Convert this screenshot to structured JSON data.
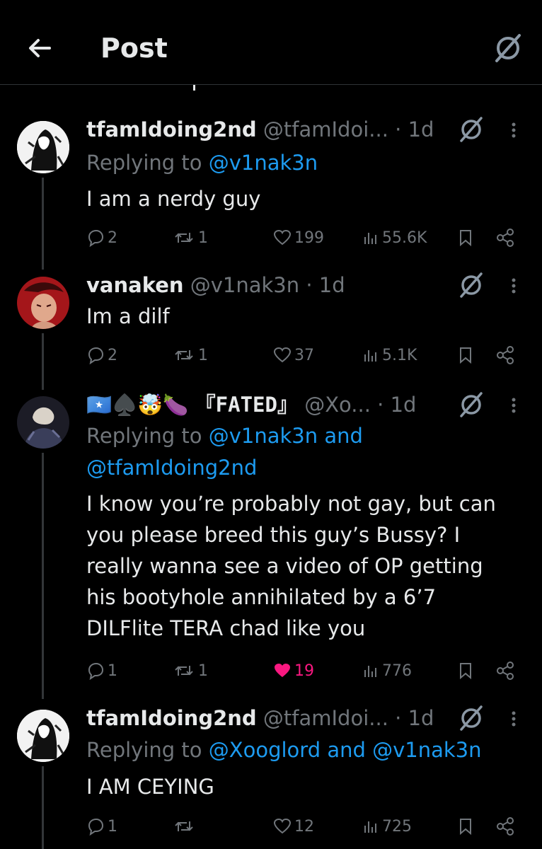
{
  "header": {
    "title": "Post"
  },
  "tweets": [
    {
      "name": "tfamIdoing2nd",
      "handle": "@tfamIdoi...",
      "time": "· 1d",
      "replying_prefix": "Replying to ",
      "replying_to_1": "@v1nak3n",
      "text": "I am a nerdy guy",
      "replies": "2",
      "reposts": "1",
      "likes": "199",
      "views": "55.6K"
    },
    {
      "name": "vanaken",
      "handle": "@v1nak3n",
      "time": "· 1d",
      "text": "Im a dilf",
      "replies": "2",
      "reposts": "1",
      "likes": "37",
      "views": "5.1K"
    },
    {
      "name_emoji": "🇸🇴♠️🤯🍆",
      "name": "『FATED』",
      "handle": "@Xo...",
      "time": "· 1d",
      "replying_prefix": "Replying to ",
      "replying_to_1": "@v1nak3n",
      "replying_and": " and",
      "replying_to_2": "@tfamIdoing2nd",
      "text_lines": [
        "I know you’re probably not gay, but can",
        "you please breed this guy’s Bussy? I",
        "really wanna see a video of OP getting",
        "his bootyhole annihilated by a 6’7",
        "DILFlite TERA chad like you"
      ],
      "replies": "1",
      "reposts": "1",
      "likes": "19",
      "views": "776"
    },
    {
      "name": "tfamIdoing2nd",
      "handle": "@tfamIdoi...",
      "time": "· 1d",
      "replying_prefix": "Replying to ",
      "replying_to_1": "@Xooglord",
      "replying_and": " and ",
      "replying_to_2": "@v1nak3n",
      "text": "I AM CEYING",
      "replies": "1",
      "reposts": "",
      "likes": "12",
      "views": "725"
    }
  ],
  "colors": {
    "background": "#000000",
    "text": "#e7e9ea",
    "muted": "#71767b",
    "accent": "#1d9bf0",
    "like_active": "#f91880"
  }
}
